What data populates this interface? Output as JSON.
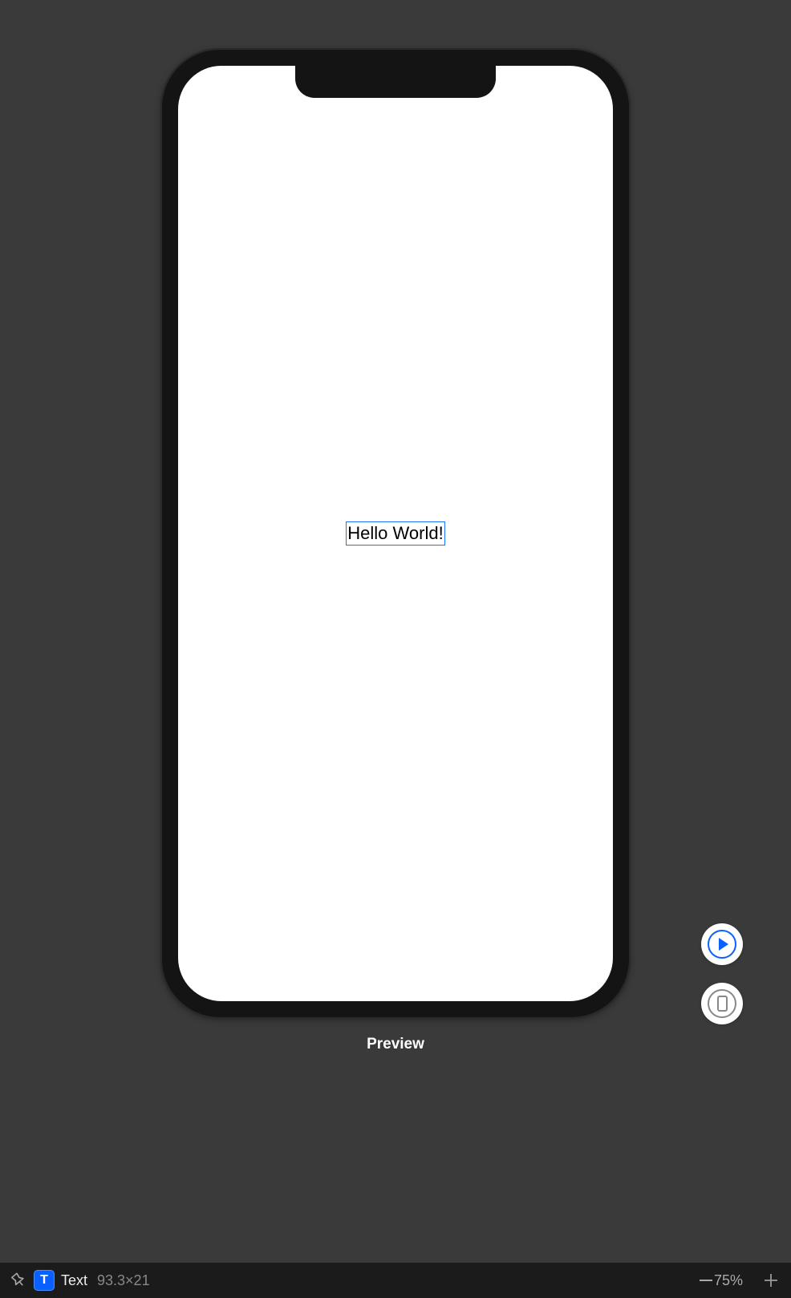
{
  "canvas": {
    "preview_label": "Preview",
    "text_element": "Hello World!"
  },
  "side_controls": {
    "play": "play-icon",
    "device": "device-icon"
  },
  "bottom_bar": {
    "pin": "pin-icon",
    "type_badge": "T",
    "element_type": "Text",
    "element_dimensions": "93.3×21",
    "zoom_level": "75%",
    "add": "plus-icon"
  }
}
